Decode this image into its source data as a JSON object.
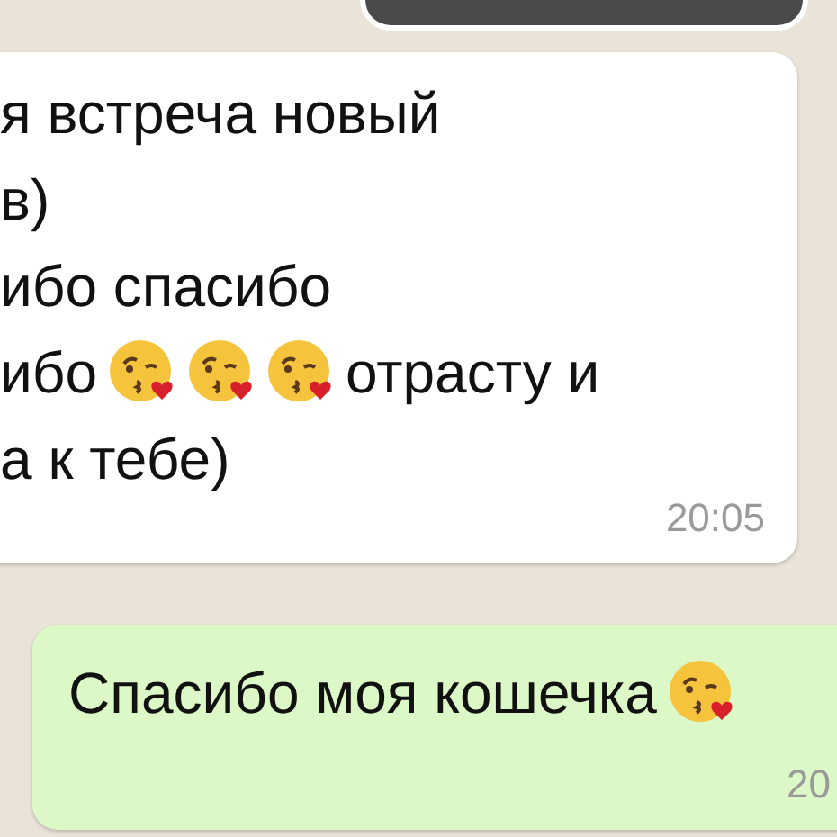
{
  "incoming": {
    "lines": [
      [
        {
          "kind": "text",
          "text": "я встреча новый"
        }
      ],
      [
        {
          "kind": "text",
          "text": "в)"
        }
      ],
      [
        {
          "kind": "text",
          "text": "ибо спасибо"
        }
      ],
      [
        {
          "kind": "text",
          "text": "ибо"
        },
        {
          "kind": "emoji"
        },
        {
          "kind": "emoji"
        },
        {
          "kind": "emoji"
        },
        {
          "kind": "text",
          "text": "отрасту и"
        }
      ],
      [
        {
          "kind": "text",
          "text": "а к тебе)"
        }
      ]
    ],
    "time": "20:05"
  },
  "outgoing": {
    "lines": [
      [
        {
          "kind": "text",
          "text": "Спасибо моя кошечка"
        },
        {
          "kind": "emoji"
        }
      ]
    ],
    "time": "20"
  }
}
